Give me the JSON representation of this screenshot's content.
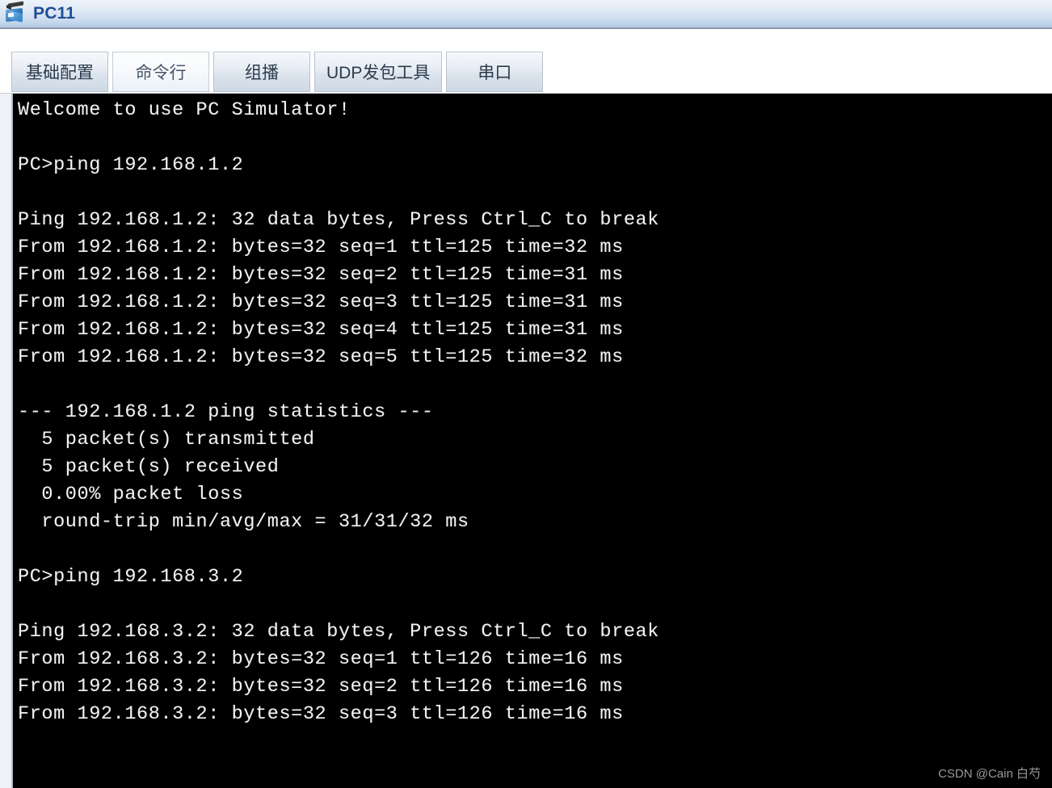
{
  "window": {
    "title": "PC11",
    "icon": "pc-device-icon"
  },
  "tabs": [
    {
      "label": "基础配置",
      "active": false
    },
    {
      "label": "命令行",
      "active": true
    },
    {
      "label": "组播",
      "active": false
    },
    {
      "label": "UDP发包工具",
      "active": false
    },
    {
      "label": "串口",
      "active": false
    }
  ],
  "terminal": {
    "prompt": "PC>",
    "banner": "Welcome to use PC Simulator!",
    "lines": [
      "Welcome to use PC Simulator!",
      "",
      "PC>ping 192.168.1.2",
      "",
      "Ping 192.168.1.2: 32 data bytes, Press Ctrl_C to break",
      "From 192.168.1.2: bytes=32 seq=1 ttl=125 time=32 ms",
      "From 192.168.1.2: bytes=32 seq=2 ttl=125 time=31 ms",
      "From 192.168.1.2: bytes=32 seq=3 ttl=125 time=31 ms",
      "From 192.168.1.2: bytes=32 seq=4 ttl=125 time=31 ms",
      "From 192.168.1.2: bytes=32 seq=5 ttl=125 time=32 ms",
      "",
      "--- 192.168.1.2 ping statistics ---",
      "  5 packet(s) transmitted",
      "  5 packet(s) received",
      "  0.00% packet loss",
      "  round-trip min/avg/max = 31/31/32 ms",
      "",
      "PC>ping 192.168.3.2",
      "",
      "Ping 192.168.3.2: 32 data bytes, Press Ctrl_C to break",
      "From 192.168.3.2: bytes=32 seq=1 ttl=126 time=16 ms",
      "From 192.168.3.2: bytes=32 seq=2 ttl=126 time=16 ms",
      "From 192.168.3.2: bytes=32 seq=3 ttl=126 time=16 ms"
    ],
    "text": "Welcome to use PC Simulator!\n\nPC>ping 192.168.1.2\n\nPing 192.168.1.2: 32 data bytes, Press Ctrl_C to break\nFrom 192.168.1.2: bytes=32 seq=1 ttl=125 time=32 ms\nFrom 192.168.1.2: bytes=32 seq=2 ttl=125 time=31 ms\nFrom 192.168.1.2: bytes=32 seq=3 ttl=125 time=31 ms\nFrom 192.168.1.2: bytes=32 seq=4 ttl=125 time=31 ms\nFrom 192.168.1.2: bytes=32 seq=5 ttl=125 time=32 ms\n\n--- 192.168.1.2 ping statistics ---\n  5 packet(s) transmitted\n  5 packet(s) received\n  0.00% packet loss\n  round-trip min/avg/max = 31/31/32 ms\n\nPC>ping 192.168.3.2\n\nPing 192.168.3.2: 32 data bytes, Press Ctrl_C to break\nFrom 192.168.3.2: bytes=32 seq=1 ttl=126 time=16 ms\nFrom 192.168.3.2: bytes=32 seq=2 ttl=126 time=16 ms\nFrom 192.168.3.2: bytes=32 seq=3 ttl=126 time=16 ms",
    "sessions": [
      {
        "command": "ping 192.168.1.2",
        "target": "192.168.1.2",
        "data_bytes": 32,
        "replies": [
          {
            "seq": 1,
            "bytes": 32,
            "ttl": 125,
            "time_ms": 32
          },
          {
            "seq": 2,
            "bytes": 32,
            "ttl": 125,
            "time_ms": 31
          },
          {
            "seq": 3,
            "bytes": 32,
            "ttl": 125,
            "time_ms": 31
          },
          {
            "seq": 4,
            "bytes": 32,
            "ttl": 125,
            "time_ms": 31
          },
          {
            "seq": 5,
            "bytes": 32,
            "ttl": 125,
            "time_ms": 32
          }
        ],
        "statistics": {
          "transmitted": 5,
          "received": 5,
          "loss_percent": "0.00%",
          "round_trip": "31/31/32 ms"
        }
      },
      {
        "command": "ping 192.168.3.2",
        "target": "192.168.3.2",
        "data_bytes": 32,
        "replies": [
          {
            "seq": 1,
            "bytes": 32,
            "ttl": 126,
            "time_ms": 16
          },
          {
            "seq": 2,
            "bytes": 32,
            "ttl": 126,
            "time_ms": 16
          },
          {
            "seq": 3,
            "bytes": 32,
            "ttl": 126,
            "time_ms": 16
          }
        ]
      }
    ]
  },
  "watermark": "CSDN @Cain 白芍",
  "colors": {
    "title_text": "#1f4e96",
    "terminal_bg": "#000000",
    "terminal_fg": "#f2f2f2",
    "titlebar_top": "#eef3fa",
    "titlebar_bottom": "#b3cbe4"
  }
}
